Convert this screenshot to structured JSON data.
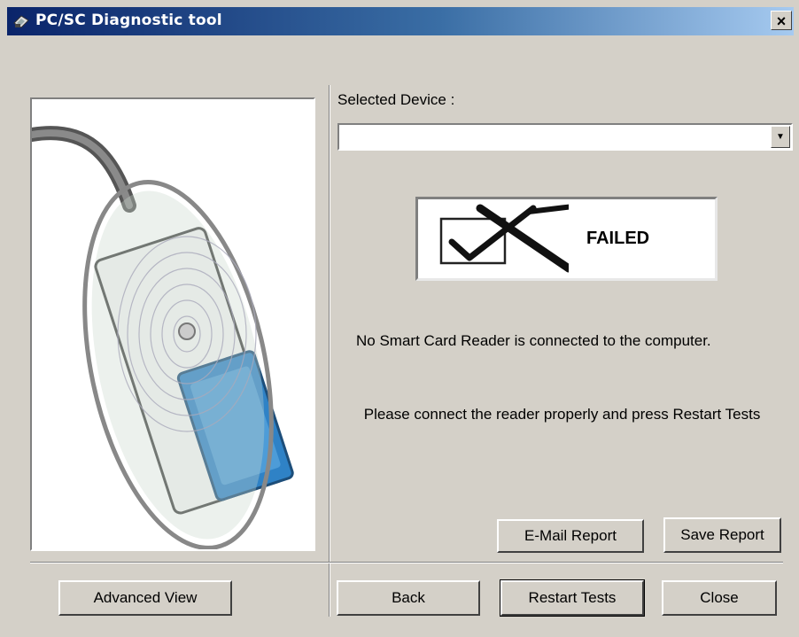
{
  "window": {
    "title": "PC/SC Diagnostic tool",
    "close_glyph": "×"
  },
  "device": {
    "label": "Selected Device :",
    "selected_value": ""
  },
  "status": {
    "text": "FAILED"
  },
  "messages": {
    "line1": "No Smart Card Reader is connected to the computer.",
    "line2": " Please connect the reader properly and press Restart Tests"
  },
  "buttons": {
    "email_report": "E-Mail Report",
    "save_report": "Save Report",
    "advanced_view": "Advanced View",
    "back": "Back",
    "restart_tests": "Restart Tests",
    "close": "Close"
  },
  "icons": {
    "app": "reader-app-icon",
    "status": "failed-check-icon",
    "illustration": "smart-card-reader-illustration"
  },
  "colors": {
    "titlebar_start": "#0a246a",
    "titlebar_end": "#a6caf0",
    "face": "#d4d0c8",
    "card_blue": "#2f82c6"
  }
}
